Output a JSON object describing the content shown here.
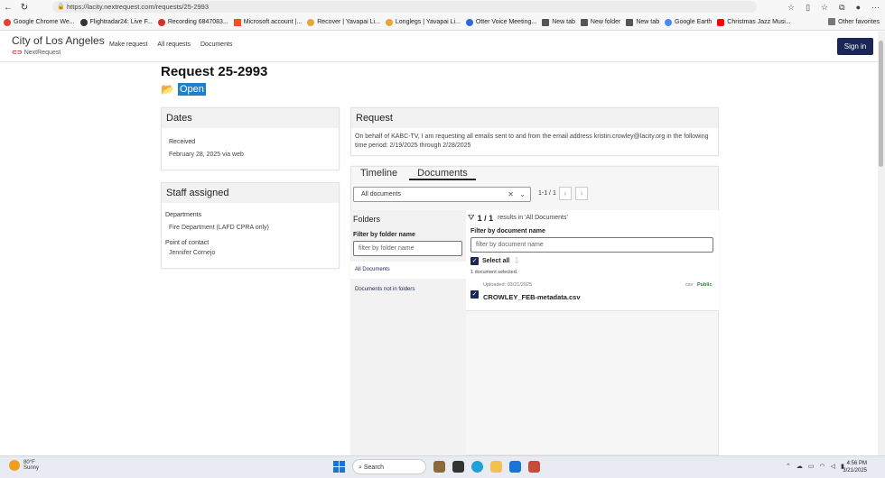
{
  "browser": {
    "url": "https://lacity.nextrequest.com/requests/25-2993",
    "bookmarks": [
      {
        "label": "Google Chrome We...",
        "color": "#e34133"
      },
      {
        "label": "Flightradar24: Live F...",
        "color": "#333333"
      },
      {
        "label": "Recording 6847083...",
        "color": "#d93025"
      },
      {
        "label": "Microsoft account |...",
        "color": "#f25022"
      },
      {
        "label": "Recover | Yavapai Li...",
        "color": "#e8a53a"
      },
      {
        "label": "Longlegs | Yavapai Li...",
        "color": "#e8a53a"
      },
      {
        "label": "Otter Voice Meeting...",
        "color": "#2c6ad7"
      },
      {
        "label": "New tab",
        "color": "#555555"
      },
      {
        "label": "New folder",
        "color": "#555555"
      },
      {
        "label": "New tab",
        "color": "#555555"
      },
      {
        "label": "Google Earth",
        "color": "#4a8af4"
      },
      {
        "label": "Christmas Jazz Musi...",
        "color": "#ff0000"
      }
    ],
    "other_favorites": "Other favorites"
  },
  "site": {
    "brand_title": "City of Los Angeles",
    "brand_sub": "NextRequest",
    "nav": [
      "Make request",
      "All requests",
      "Documents"
    ],
    "signin_label": "Sign in"
  },
  "request": {
    "title": "Request 25-2993",
    "status": "Open"
  },
  "dates_card": {
    "heading": "Dates",
    "received_label": "Received",
    "received_value": "February 28, 2025 via web"
  },
  "staff_card": {
    "heading": "Staff assigned",
    "departments_label": "Departments",
    "departments_value": "Fire Department (LAFD CPRA only)",
    "poc_label": "Point of contact",
    "poc_value": "Jennifer Cornejo"
  },
  "request_card": {
    "heading": "Request",
    "body": "On behalf of KABC-TV, I am requesting all emails sent to and from the email address kristin.crowley@lacity.org in the following time period: 2/19/2025 through 2/28/2025"
  },
  "documents_panel": {
    "tabs": [
      "Timeline",
      "Documents"
    ],
    "active_tab": "Documents",
    "select_value": "All documents",
    "pager_text": "1-1 / 1",
    "folders_heading": "Folders",
    "folder_filter_label": "Filter by folder name",
    "folder_filter_placeholder": "filter by folder name",
    "folder_items": [
      "All Documents",
      "Documents not in folders"
    ],
    "results_count": "1 / 1",
    "results_suffix": "results in 'All Documents'",
    "doc_filter_label": "Filter by document name",
    "doc_filter_placeholder": "filter by document name",
    "select_all_label": "Select all",
    "selected_text": "1 document selected.",
    "documents": [
      {
        "uploaded": "Uploaded: 03/21/2025",
        "name": "CROWLEY_FEB-metadata.csv",
        "type": "csv",
        "visibility": "Public"
      }
    ]
  },
  "taskbar": {
    "temp": "80°F",
    "condition": "Sunny",
    "search_label": "Search",
    "time": "4:56 PM",
    "date": "3/21/2025"
  },
  "colors": {
    "brand_navy": "#1a2757",
    "status_blue": "#1f7fcf",
    "public_green": "#2e7d32"
  }
}
